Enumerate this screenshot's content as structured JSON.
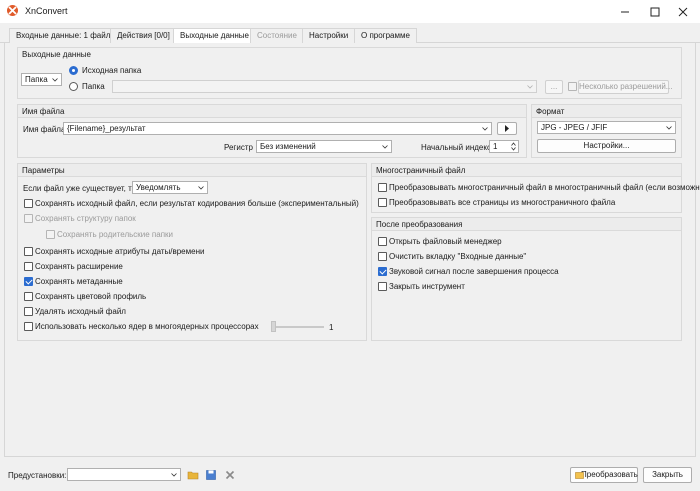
{
  "window": {
    "title": "XnConvert"
  },
  "tabs": [
    {
      "label": "Входные данные: 1 файл"
    },
    {
      "label": "Действия [0/0]"
    },
    {
      "label": "Выходные данные"
    },
    {
      "label": "Состояние"
    },
    {
      "label": "Настройки"
    },
    {
      "label": "О программе"
    }
  ],
  "output": {
    "title": "Выходные данные",
    "mode_select": "Папка",
    "radio_source": "Исходная папка",
    "radio_folder": "Папка",
    "browse": "...",
    "multi_res": "Несколько разрешений..."
  },
  "filename": {
    "title": "Имя файла",
    "label": "Имя файла",
    "value": "{Filename}_результат",
    "case_label": "Регистр",
    "case_value": "Без изменений",
    "start_label": "Начальный индекс",
    "start_value": "1"
  },
  "format": {
    "title": "Формат",
    "value": "JPG - JPEG / JFIF",
    "settings": "Настройки..."
  },
  "params": {
    "title": "Параметры",
    "exists_label": "Если файл уже существует, то",
    "exists_value": "Уведомлять",
    "items": [
      "Сохранять исходный файл, если результат кодирования больше (экспериментальный)",
      "Сохранять структуру папок",
      "Сохранять родительские папки",
      "Сохранять исходные атрибуты даты/времени",
      "Сохранять расширение",
      "Сохранять метаданные",
      "Сохранять цветовой профиль",
      "Удалять исходный файл",
      "Использовать несколько ядер в многоядерных процессорах"
    ],
    "cores_value": "1"
  },
  "multipage": {
    "title": "Многостраничный файл",
    "items": [
      "Преобразовывать многостраничный файл в многостраничный файл (если возможно)",
      "Преобразовывать все страницы из многостраничного файла"
    ]
  },
  "after": {
    "title": "После преобразования",
    "items": [
      "Открыть файловый менеджер",
      "Очистить вкладку \"Входные данные\"",
      "Звуковой сигнал после завершения процесса",
      "Закрыть инструмент"
    ]
  },
  "bottom": {
    "presets_label": "Предустановки:",
    "convert": "Преобразовать",
    "close": "Закрыть"
  },
  "colors": {
    "accent": "#2b6cd0",
    "folder": "#e8b53a"
  }
}
